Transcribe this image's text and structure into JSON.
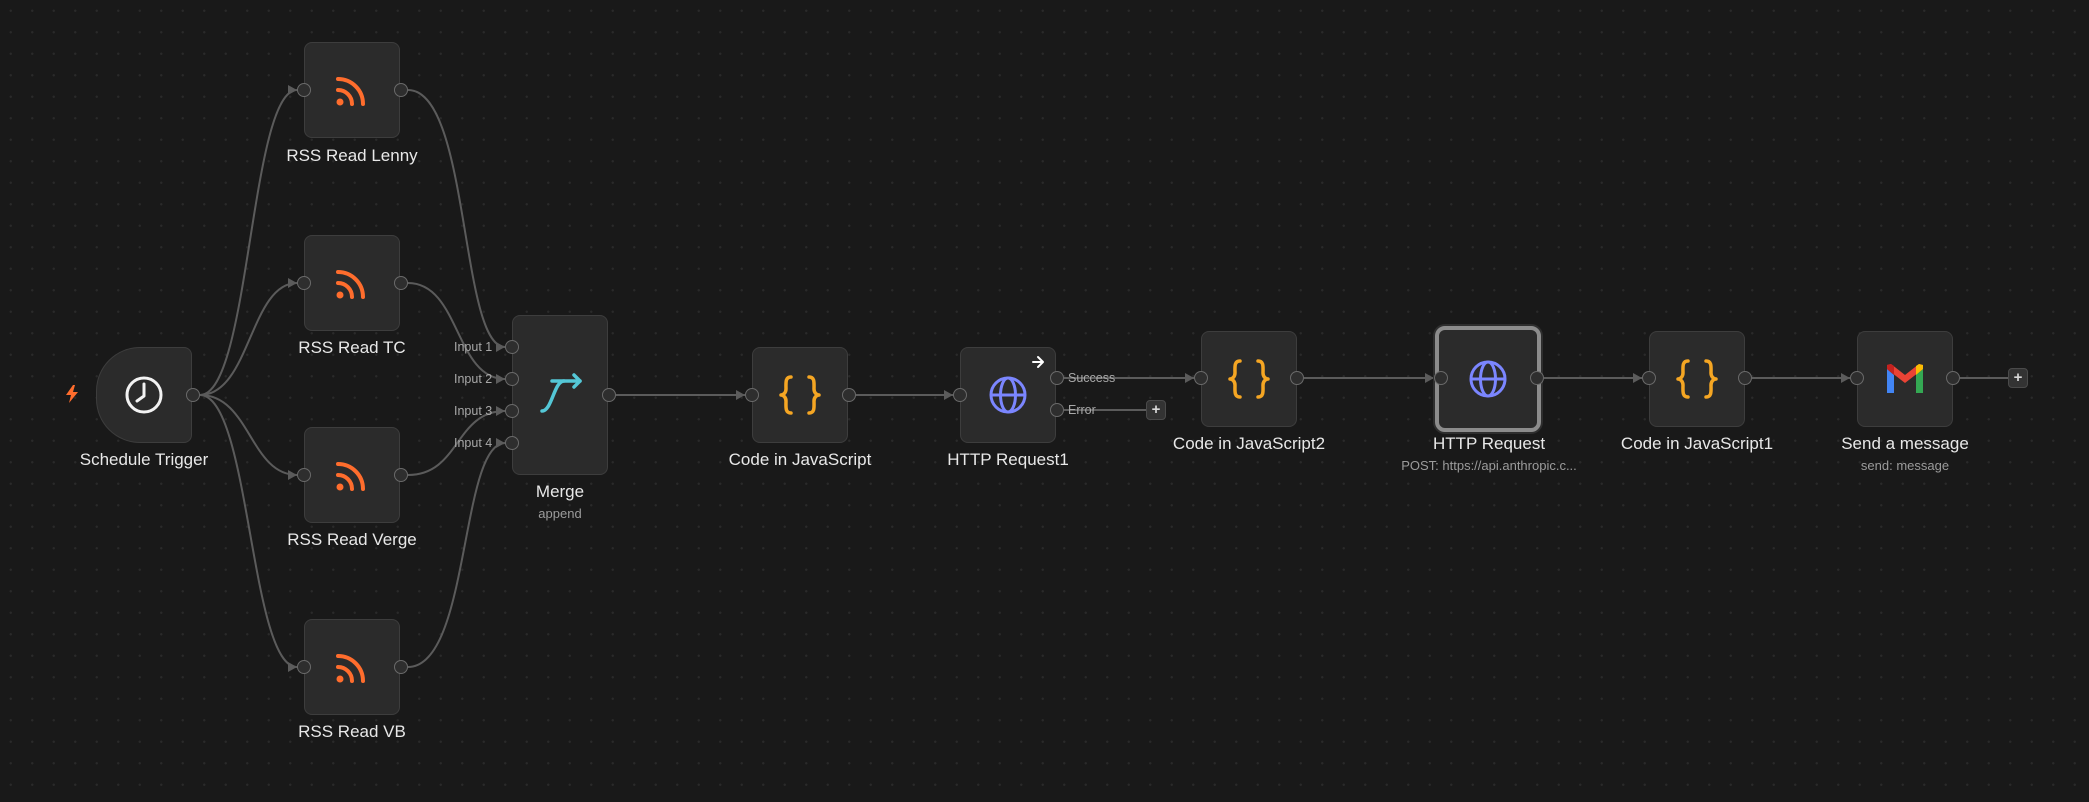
{
  "canvas": {
    "background": "#191919",
    "accent_rss": "#ff6d2d",
    "accent_code": "#f5a623",
    "accent_http": "#7b86ff",
    "accent_merge": "#54c7d6"
  },
  "nodes": {
    "schedule_trigger": {
      "label": "Schedule Trigger",
      "icon": "clock-icon"
    },
    "rss_lenny": {
      "label": "RSS Read Lenny",
      "icon": "rss-icon"
    },
    "rss_tc": {
      "label": "RSS Read TC",
      "icon": "rss-icon"
    },
    "rss_verge": {
      "label": "RSS Read Verge",
      "icon": "rss-icon"
    },
    "rss_vb": {
      "label": "RSS Read VB",
      "icon": "rss-icon"
    },
    "merge": {
      "label": "Merge",
      "sublabel": "append",
      "icon": "merge-icon",
      "inputs": [
        "Input 1",
        "Input 2",
        "Input 3",
        "Input 4"
      ]
    },
    "code_js": {
      "label": "Code in JavaScript",
      "icon": "code-braces-icon"
    },
    "http_request1": {
      "label": "HTTP Request1",
      "icon": "globe-icon",
      "outputs": [
        "Success",
        "Error"
      ]
    },
    "code_js2": {
      "label": "Code in JavaScript2",
      "icon": "code-braces-icon"
    },
    "http_request": {
      "label": "HTTP Request",
      "sublabel": "POST: https://api.anthropic.c...",
      "icon": "globe-icon"
    },
    "code_js1": {
      "label": "Code in JavaScript1",
      "icon": "code-braces-icon"
    },
    "send_message": {
      "label": "Send a message",
      "sublabel": "send: message",
      "icon": "gmail-icon"
    }
  },
  "add_buttons": {
    "symbol": "+"
  }
}
